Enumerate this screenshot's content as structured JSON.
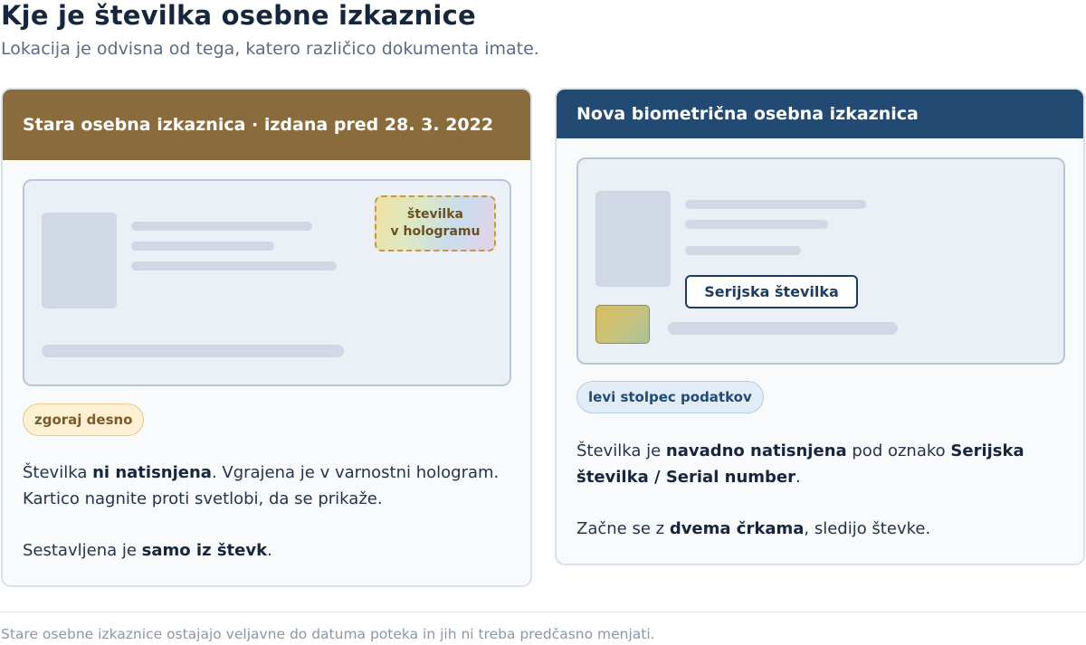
{
  "title": "Kje je številka osebne izkaznice",
  "subtitle": "Lokacija je odvisna od tega, katero različico dokumenta imate.",
  "old_card": {
    "header": "Stara osebna izkaznica  ·  izdana pred 28. 3. 2022",
    "hologram_line1": "številka",
    "hologram_line2": "v hologramu",
    "badge": "zgoraj desno",
    "p1_a": "Številka ",
    "p1_b": "ni natisnjena",
    "p1_c": ". Vgrajena je v varnostni hologram. Kartico nagnite proti svetlobi, da se prikaže.",
    "p2_a": "Sestavljena je ",
    "p2_b": "samo iz števk",
    "p2_c": "."
  },
  "new_card": {
    "header": "Nova biometrična osebna izkaznica",
    "serial_label": "Serijska številka",
    "badge": "levi stolpec podatkov",
    "p1_a": "Številka je ",
    "p1_b": "navadno natisnjena",
    "p1_c": " pod oznako ",
    "p1_d": "Serijska številka / Serial number",
    "p1_e": ".",
    "p2_a": "Začne se z ",
    "p2_b": "dvema črkama",
    "p2_c": ", sledijo števke."
  },
  "footnote": "Stare osebne izkaznice ostajajo veljavne do datuma poteka in jih ni treba predčasno menjati.",
  "colors": {
    "old_header": "#8a6c3c",
    "new_header": "#224a72",
    "old_badge_bg": "#fdf0d3",
    "new_badge_bg": "#e2ecf7"
  }
}
